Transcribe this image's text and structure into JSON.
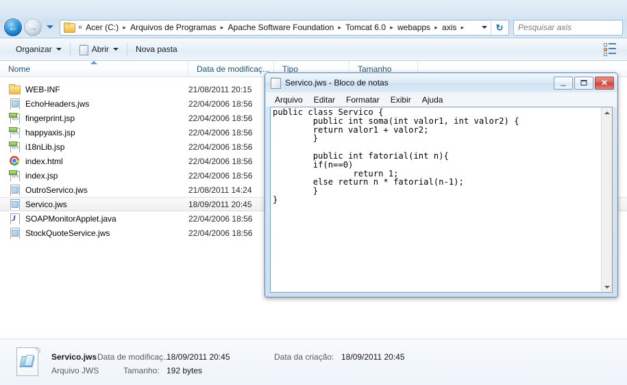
{
  "explorer": {
    "nav": {
      "back_icon": "back-arrow-icon",
      "forward_icon": "forward-arrow-icon",
      "history_icon": "chevron-down-icon",
      "folder_icon": "folder-icon",
      "overflow_chevrons": "«",
      "breadcrumbs": [
        "Acer (C:)",
        "Arquivos de Programas",
        "Apache Software Foundation",
        "Tomcat 6.0",
        "webapps",
        "axis"
      ],
      "breadcrumb_separator": "▸",
      "address_dropdown_icon": "chevron-down-icon",
      "refresh_icon": "refresh-icon",
      "refresh_glyph": "↻"
    },
    "search": {
      "placeholder": "Pesquisar axis",
      "value": ""
    },
    "command_bar": {
      "organize_label": "Organizar",
      "open_label": "Abrir",
      "new_folder_label": "Nova pasta",
      "view_layout_icon": "view-layout-icon"
    },
    "columns": [
      {
        "key": "nome",
        "label": "Nome",
        "sorted": "asc"
      },
      {
        "key": "data",
        "label": "Data de modificaç...",
        "sorted": ""
      },
      {
        "key": "tipo",
        "label": "Tipo",
        "sorted": ""
      },
      {
        "key": "tamanho",
        "label": "Tamanho",
        "sorted": ""
      }
    ],
    "files": [
      {
        "name": "WEB-INF",
        "date": "21/08/2011 20:15",
        "icon": "folder",
        "selected": false
      },
      {
        "name": "EchoHeaders.jws",
        "date": "22/04/2006 18:56",
        "icon": "jws",
        "selected": false
      },
      {
        "name": "fingerprint.jsp",
        "date": "22/04/2006 18:56",
        "icon": "jsp",
        "selected": false
      },
      {
        "name": "happyaxis.jsp",
        "date": "22/04/2006 18:56",
        "icon": "jsp",
        "selected": false
      },
      {
        "name": "i18nLib.jsp",
        "date": "22/04/2006 18:56",
        "icon": "jsp",
        "selected": false
      },
      {
        "name": "index.html",
        "date": "22/04/2006 18:56",
        "icon": "chrome",
        "selected": false
      },
      {
        "name": "index.jsp",
        "date": "22/04/2006 18:56",
        "icon": "jsp",
        "selected": false
      },
      {
        "name": "OutroServico.jws",
        "date": "21/08/2011 14:24",
        "icon": "jws",
        "selected": false
      },
      {
        "name": "Servico.jws",
        "date": "18/09/2011 20:45",
        "icon": "jws",
        "selected": true
      },
      {
        "name": "SOAPMonitorApplet.java",
        "date": "22/04/2006 18:56",
        "icon": "java",
        "selected": false
      },
      {
        "name": "StockQuoteService.jws",
        "date": "22/04/2006 18:56",
        "icon": "jws",
        "selected": false
      }
    ],
    "details": {
      "file_icon": "jws-file-icon",
      "name": "Servico.jws",
      "type": "Arquivo JWS",
      "modified_label": "Data de modificaç...",
      "modified_value": "18/09/2011 20:45",
      "size_label": "Tamanho:",
      "size_value": "192 bytes",
      "created_label": "Data da criação:",
      "created_value": "18/09/2011 20:45"
    }
  },
  "notepad": {
    "title": "Servico.jws - Bloco de notas",
    "title_icon": "notepad-icon",
    "window_buttons": {
      "minimize_icon": "minimize-icon",
      "minimize_glyph": "–",
      "maximize_icon": "maximize-icon",
      "close_icon": "close-icon",
      "close_glyph": "✕"
    },
    "menus": [
      "Arquivo",
      "Editar",
      "Formatar",
      "Exibir",
      "Ajuda"
    ],
    "scrollbar": {
      "up_icon": "scroll-up-icon",
      "down_icon": "scroll-down-icon"
    },
    "content": "public class Servico {\n        public int soma(int valor1, int valor2) {\n        return valor1 + valor2;\n        }\n\n        public int fatorial(int n){\n        if(n==0)\n                return 1;\n        else return n * fatorial(n-1);\n        }\n}"
  },
  "colors": {
    "accent_blue": "#1272c4",
    "chrome_frame": "#d6e6f4",
    "selection": "#f0f0f0",
    "close_red": "#c8423c",
    "header_text": "#22527a"
  }
}
